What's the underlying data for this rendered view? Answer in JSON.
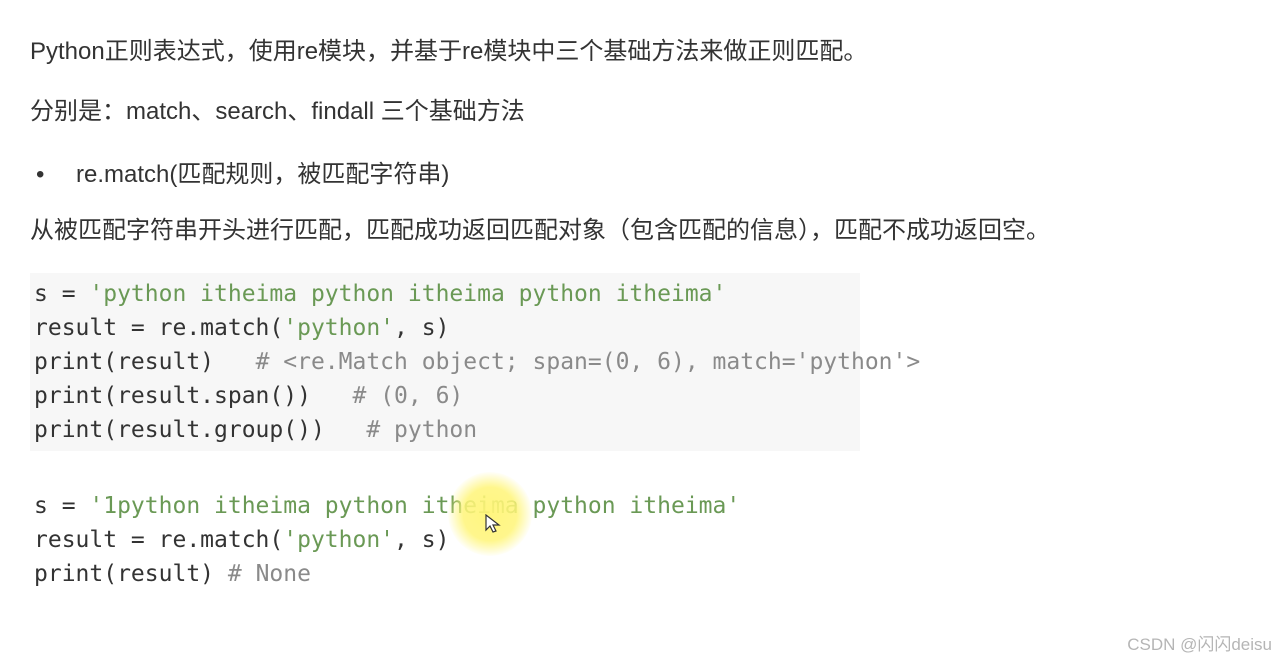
{
  "text": {
    "para1": "Python正则表达式，使用re模块，并基于re模块中三个基础方法来做正则匹配。",
    "para2": "分别是：match、search、findall 三个基础方法",
    "bullet_dot": "•",
    "bullet_text": "re.match(匹配规则，被匹配字符串)",
    "para3": "从被匹配字符串开头进行匹配，匹配成功返回匹配对象（包含匹配的信息），匹配不成功返回空。"
  },
  "code1": {
    "l1a": "s = ",
    "l1b": "'python itheima python itheima python itheima'",
    "blank": "",
    "l2a": "result = re.match(",
    "l2b": "'python'",
    "l2c": ", s)",
    "l3a": "print(result)   ",
    "l3b": "# <re.Match object; span=(0, 6), match='python'>",
    "l4a": "print(result.span())   ",
    "l4b": "# (0, 6)",
    "l5a": "print(result.group())   ",
    "l5b": "# python"
  },
  "code2": {
    "l1a": "s = ",
    "l1b": "'1python itheima python itheima python itheima'",
    "blank": "",
    "l2a": "result = re.match(",
    "l2b": "'python'",
    "l2c": ", s)",
    "l3a": "print(result) ",
    "l3b": "# None"
  },
  "watermark": "CSDN @闪闪deisu"
}
